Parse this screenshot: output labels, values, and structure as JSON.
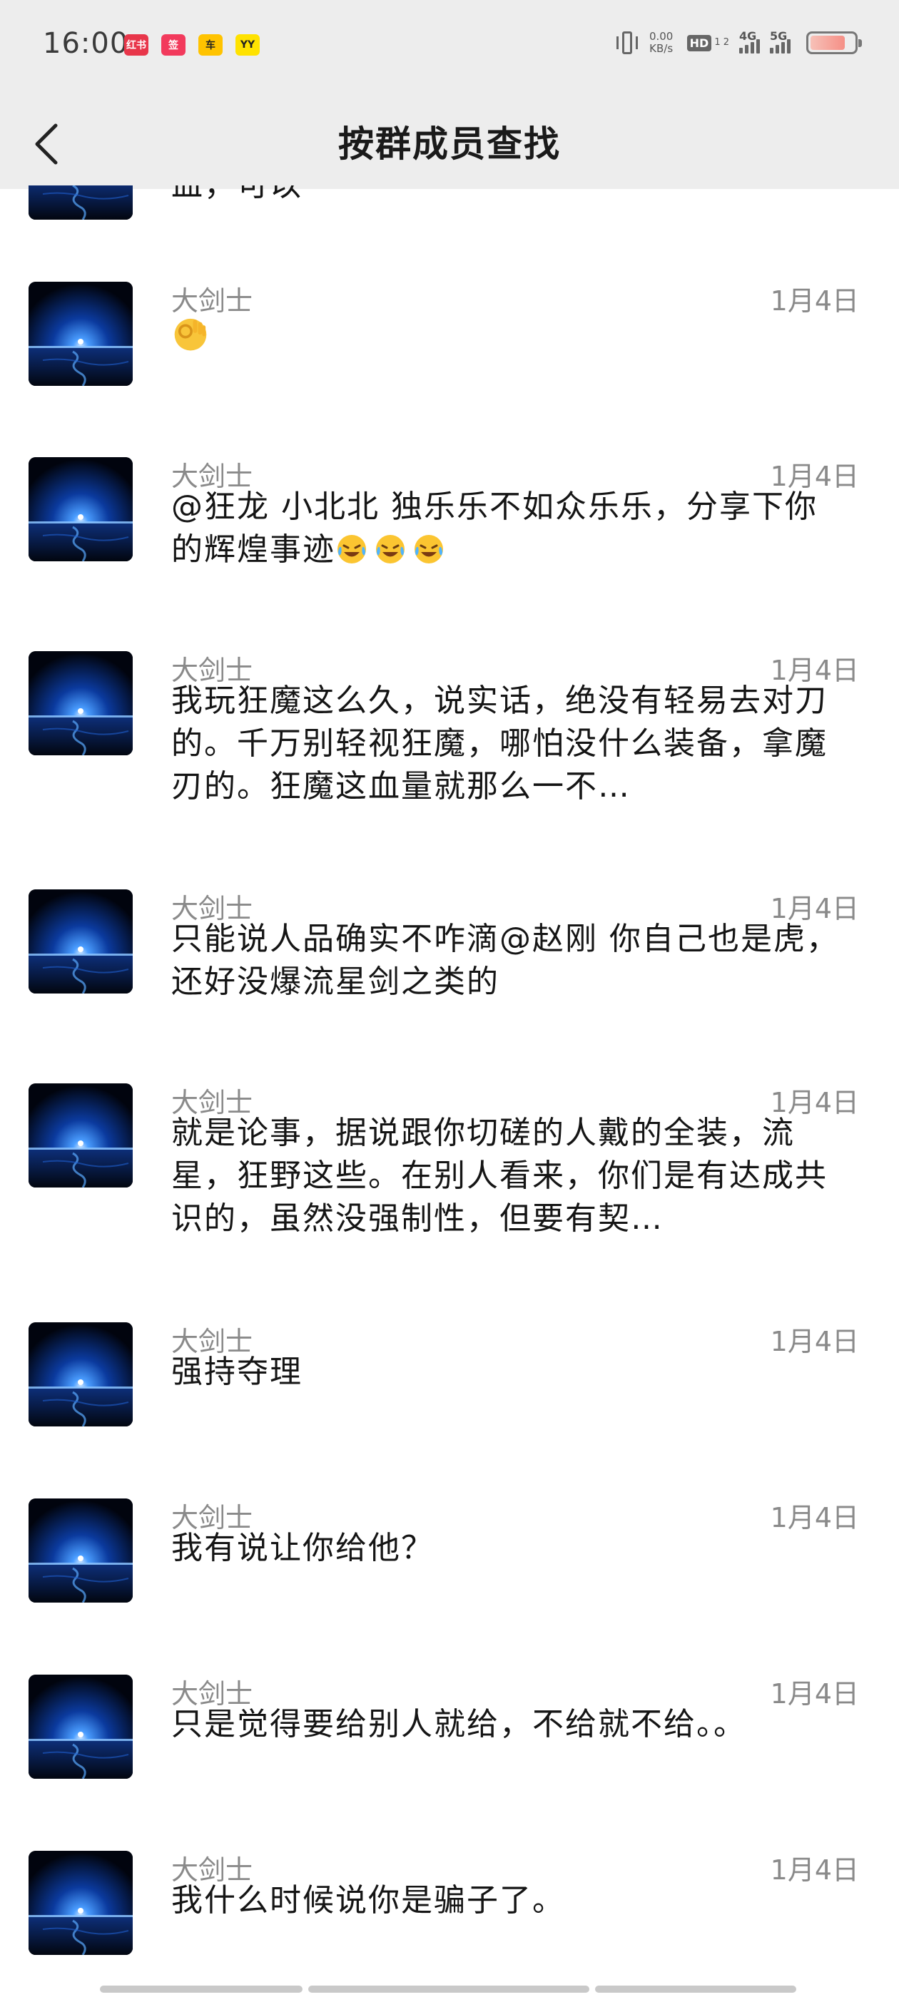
{
  "status_bar": {
    "time": "16:00",
    "apps": [
      "红书",
      "签",
      "车",
      "YY"
    ],
    "net_speed_value": "0.00",
    "net_speed_unit": "KB/s",
    "hd_label": "HD",
    "hd_sub": "1 2",
    "signal_1": "4G",
    "signal_2": "5G",
    "battery_level": 0.8,
    "battery_color": "#f58f86"
  },
  "navbar": {
    "back_icon": "chevron-left-icon",
    "title": "按群成员查找"
  },
  "partial_message": {
    "text": "血，可以"
  },
  "messages": [
    {
      "sender": "大剑士",
      "date": "1月4日",
      "emoji": "ok-hand",
      "text": ""
    },
    {
      "sender": "大剑士",
      "date": "1月4日",
      "text": "@狂龙 小北北  独乐乐不如众乐乐，分享下你的辉煌事迹",
      "emoji_tail": "laugh-cry x3"
    },
    {
      "sender": "大剑士",
      "date": "1月4日",
      "text": "我玩狂魔这么久，说实话，绝没有轻易去对刀的。千万别轻视狂魔，哪怕没什么装备，拿魔刃的。狂魔这血量就那么一不…"
    },
    {
      "sender": "大剑士",
      "date": "1月4日",
      "text": "只能说人品确实不咋滴@赵刚 你自己也是虎，还好没爆流星剑之类的"
    },
    {
      "sender": "大剑士",
      "date": "1月4日",
      "text": "就是论事，据说跟你切磋的人戴的全装，流星，狂野这些。在别人看来，你们是有达成共识的，虽然没强制性，但要有契…"
    },
    {
      "sender": "大剑士",
      "date": "1月4日",
      "text": "强持夺理"
    },
    {
      "sender": "大剑士",
      "date": "1月4日",
      "text": "我有说让你给他？"
    },
    {
      "sender": "大剑士",
      "date": "1月4日",
      "text": "只是觉得要给别人就给，不给就不给。。"
    },
    {
      "sender": "大剑士",
      "date": "1月4日",
      "text": "我什么时候说你是骗子了。"
    }
  ],
  "colors": {
    "header_bg": "#ededed",
    "secondary_text": "#8a8a8a",
    "primary_text": "#151515",
    "avatar_glow": "#2d7bff"
  }
}
